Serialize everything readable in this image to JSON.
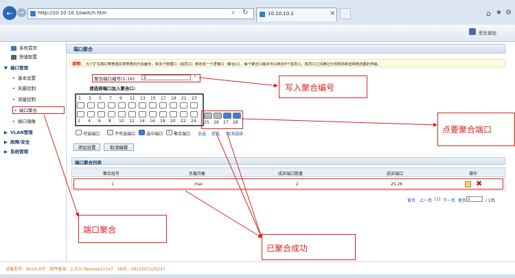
{
  "browser": {
    "url": "http://10.10.10.1/switch.htm",
    "tab_title": "10.10.10.1",
    "search_glyph": "⌕",
    "refresh_glyph": "↻",
    "close_glyph": "×",
    "home_glyph": "⌂",
    "star_glyph": "★",
    "gear_glyph": "⚙",
    "back_glyph": "←",
    "forward_glyph": "→"
  },
  "header": {
    "logout_label": "安全退出"
  },
  "sidebar": {
    "items": [
      {
        "label": "系统首页"
      },
      {
        "label": "快速配置"
      },
      {
        "label": "端口管理"
      },
      {
        "label": "基本设置"
      },
      {
        "label": "风暴控制"
      },
      {
        "label": "流量控制"
      },
      {
        "label": "端口聚合"
      },
      {
        "label": "端口镜像"
      },
      {
        "label": "VLAN管理"
      },
      {
        "label": "故障/安全"
      },
      {
        "label": "系统管理"
      }
    ]
  },
  "page": {
    "title": "端口聚合",
    "notice_label": "说明：",
    "notice_text": "为了扩充端口带宽或实现带宽的冗余备份，将多个物理口（成员口）绑定成一个逻辑口（聚合口），每个聚合口最多可以绑定8个成员口，成员口之间通过分流规则承担网络流量的传输。",
    "agg_id_label": "聚合端口编号(1-16):",
    "agg_id_value": "2",
    "required_mark": "*",
    "select_ports_label": "请选择端口加入聚合口:",
    "ports_top": [
      "1",
      "3",
      "5",
      "7",
      "9",
      "11",
      "13",
      "15",
      "17",
      "19",
      "21",
      "23"
    ],
    "ports_bottom": [
      "2",
      "4",
      "6",
      "8",
      "10",
      "12",
      "14",
      "16",
      "18",
      "20",
      "22",
      "24"
    ],
    "ports_extra": [
      "25",
      "26",
      "27",
      "28"
    ],
    "legend": {
      "available": "可选端口",
      "unavailable": "不可选端口",
      "selected": "选中端口",
      "aggregated": "聚合端口",
      "select_all": "全选",
      "invert": "反选",
      "cancel": "取消选择"
    },
    "add_button": "添加设置",
    "cancel_button": "取消编辑",
    "list_title": "端口聚合列表",
    "table": {
      "headers": [
        "聚合组号",
        "负载均衡",
        "成员端口数量",
        "成员端口",
        "操作"
      ],
      "rows": [
        [
          "1",
          "mac",
          "2",
          "25,26"
        ]
      ]
    },
    "pagination": {
      "first": "首页",
      "prev": "上一页",
      "current": "[1]",
      "next": "下一页",
      "last": "尾页",
      "page_input": "1",
      "total": "/ 1页"
    }
  },
  "annotations": {
    "write_id": "写入聚合编号",
    "click_ports": "点要聚合端口",
    "port_agg": "端口聚合",
    "success": "已聚合成功"
  },
  "status": {
    "model_label": "设备型号：",
    "model_value": "B024-4TF",
    "version_label": "软件版本：",
    "version_value": "2.3(1) Release11147",
    "sn_label": "SN号：",
    "sn_value": "0921507220247"
  },
  "colors": {
    "accent_red": "#d6221e",
    "link_blue": "#1a4fa0",
    "selected_port": "#3d7fd6"
  }
}
